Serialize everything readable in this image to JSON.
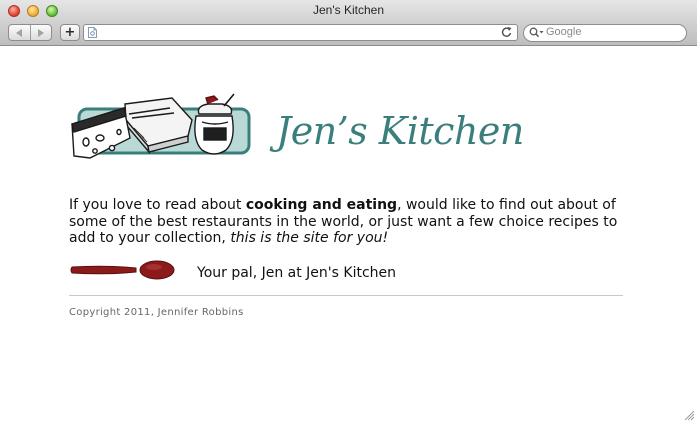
{
  "window": {
    "title": "Jen's Kitchen",
    "traffic_lights": [
      "close",
      "minimize",
      "zoom"
    ]
  },
  "toolbar": {
    "back_icon": "back-arrow-icon",
    "forward_icon": "forward-arrow-icon",
    "add_bookmark_label": "+",
    "url_value": "",
    "reload_icon": "reload-icon",
    "search_placeholder": "Google"
  },
  "page": {
    "heading": "Jen’s Kitchen",
    "intro": {
      "part1": "If you love to read about ",
      "bold": "cooking and eating",
      "part2": ", would like to find out about of some of the best restaurants in the world, or just want a few choice recipes to add to your collection, ",
      "italic": "this is the site for you!"
    },
    "signoff": "Your pal, Jen at Jen's Kitchen",
    "copyright": "Copyright 2011, Jennifer Robbins"
  },
  "colors": {
    "heading": "#3a7f7c",
    "logo_frame": "#3a7f7c",
    "logo_fill": "#b9d9d7",
    "spoon": "#8b1a1a"
  }
}
